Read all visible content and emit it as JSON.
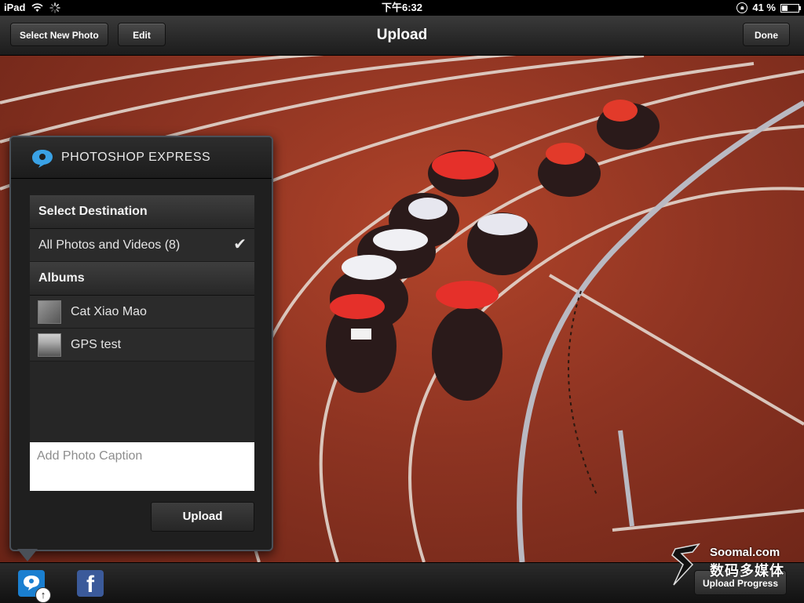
{
  "status": {
    "device": "iPad",
    "time": "下午6:32",
    "battery": "41 %",
    "battery_level": 0.41
  },
  "nav": {
    "select_photo_label": "Select New Photo",
    "edit_label": "Edit",
    "title": "Upload",
    "done_label": "Done"
  },
  "popover": {
    "title": "PHOTOSHOP EXPRESS",
    "destination_header": "Select Destination",
    "all_photos": "All Photos and Videos (8)",
    "check": "✔",
    "albums_header": "Albums",
    "albums": [
      {
        "name": "Cat Xiao Mao"
      },
      {
        "name": "GPS test"
      }
    ],
    "caption_placeholder": "Add Photo Caption",
    "upload_label": "Upload"
  },
  "toolbar": {
    "facebook_glyph": "f",
    "upload_progress_label": "Upload Progress"
  },
  "watermark": {
    "line1": "Soomal.com",
    "line2": "数码多媒体"
  },
  "colors": {
    "photoshop_blue": "#1a7fd0",
    "facebook_blue": "#3b5a9a",
    "track_red": "#9a3a25"
  }
}
